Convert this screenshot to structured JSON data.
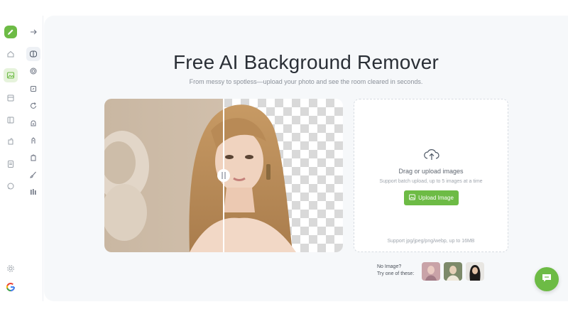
{
  "header": {
    "title": "Free AI Background Remover",
    "subtitle": "From messy to spotless—upload your photo and see the room cleared in seconds."
  },
  "upload": {
    "title": "Drag or upload images",
    "hint": "Support batch upload, up to 5 images at a time",
    "button_label": "Upload Image",
    "formats": "Support jpg/jpeg/png/webp, up to 16MB"
  },
  "samples": {
    "line1": "No Image?",
    "line2": "Try one of these:"
  },
  "preview": {
    "slider_position_pct": 50
  },
  "icons": {
    "rail": [
      "logo-pencil-icon",
      "home-icon",
      "image-icon",
      "box-icon",
      "layout-icon",
      "puzzle-icon",
      "document-icon",
      "chat-bubble-icon",
      "settings-icon",
      "google-icon"
    ],
    "tools": [
      "expand-arrow-icon",
      "compare-icon",
      "fingerprint-icon",
      "crop-icon",
      "rotate-icon",
      "stamp-icon",
      "figure-icon",
      "glove-icon",
      "brush-icon",
      "bars-icon"
    ]
  },
  "colors": {
    "accent": "#6dbb45",
    "background": "#f6f8fa"
  }
}
